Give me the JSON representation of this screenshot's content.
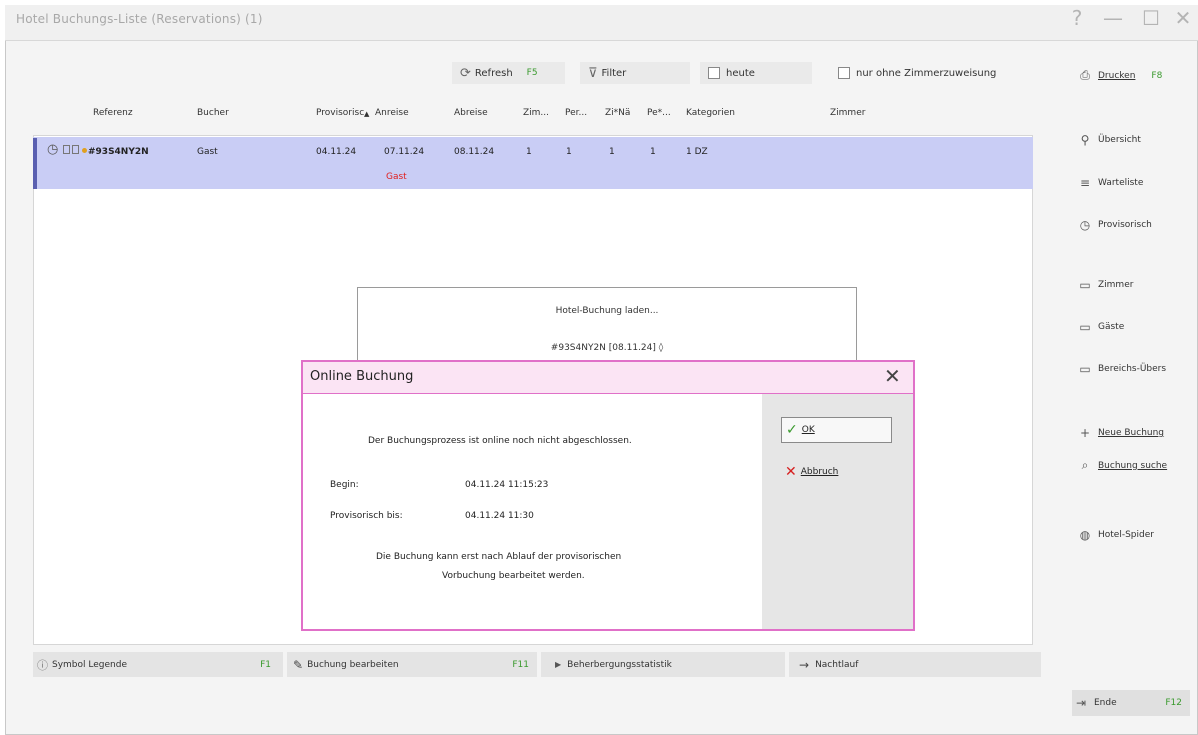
{
  "window": {
    "title": "Hotel Buchungs-Liste (Reservations) (1)",
    "help_glyph": "?",
    "minimize_glyph": "—",
    "maximize_glyph": "☐",
    "close_glyph": "✕"
  },
  "toolbar": {
    "refresh_label": "Refresh",
    "refresh_key": "F5",
    "filter_label": "Filter",
    "today_label": "heute",
    "no_room_label": "nur ohne Zimmerzuweisung"
  },
  "columns": [
    "Referenz",
    "Bucher",
    "Provisorisc",
    "Anreise",
    "Abreise",
    "Zim...",
    "Per...",
    "Zi*Nä",
    "Pe*...",
    "Kategorien",
    "Zimmer"
  ],
  "sort_indicator": "▲",
  "row": {
    "reference": "#93S4NY2N",
    "booker": "Gast",
    "provisional": "04.11.24",
    "arrival": "07.11.24",
    "departure": "08.11.24",
    "rooms": "1",
    "persons": "1",
    "room_nights": "1",
    "person_nights": "1",
    "categories": "1 DZ",
    "guest_label": "Gast"
  },
  "loading": {
    "line1": "Hotel-Buchung laden...",
    "line2": "#93S4NY2N [08.11.24] ◊"
  },
  "dialog": {
    "title": "Online Buchung",
    "message": "Der Buchungsprozess ist online noch nicht abgeschlossen.",
    "begin_label": "Begin:",
    "begin_value": "04.11.24 11:15:23",
    "provisional_label": "Provisorisch bis:",
    "provisional_value": "04.11.24 11:30",
    "note_line1": "Die Buchung kann erst nach Ablauf der provisorischen",
    "note_line2": "Vorbuchung bearbeitet werden.",
    "ok_label": "OK",
    "cancel_label": "Abbruch"
  },
  "bottom": {
    "legend_label": "Symbol Legende",
    "legend_key": "F1",
    "edit_label": "Buchung bearbeiten",
    "edit_key": "F11",
    "stats_label": "Beherbergungsstatistik",
    "night_label": "Nachtlauf"
  },
  "right_panel": {
    "print_label": "Drucken",
    "print_key": "F8",
    "overview_label": "Übersicht",
    "waitlist_label": "Warteliste",
    "provisional_label": "Provisorisch",
    "rooms_label": "Zimmer",
    "guests_label": "Gäste",
    "area_label": "Bereichs-Übers",
    "new_booking_label": "Neue Buchung",
    "search_label": "Buchung suche",
    "spider_label": "Hotel-Spider",
    "end_label": "Ende",
    "end_key": "F12"
  },
  "colors": {
    "selection": "#c9cdf5",
    "dialog_border": "#e070c8",
    "dialog_header": "#fbe4f4",
    "ok_check": "#3a9a2e",
    "cancel_x": "#d62020",
    "guest_red": "#e02020",
    "hotkey_green": "#3a9a2e"
  }
}
